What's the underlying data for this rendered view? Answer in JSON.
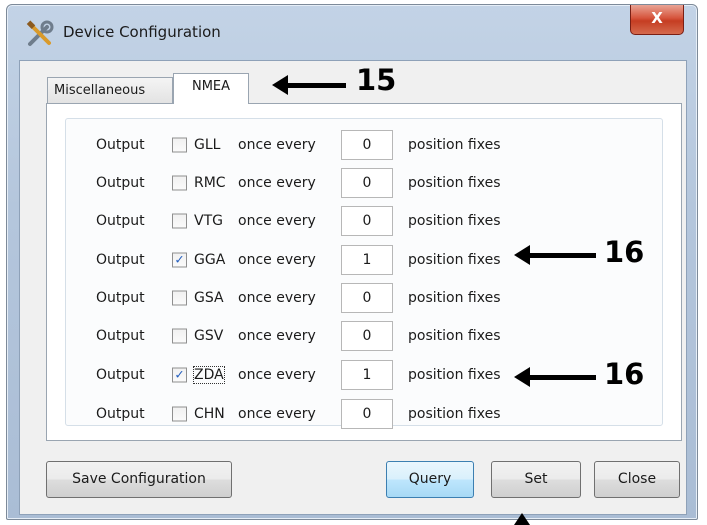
{
  "window": {
    "title": "Device Configuration",
    "close_glyph": "X"
  },
  "tabs": [
    {
      "label": "Miscellaneous",
      "selected": false
    },
    {
      "label": "NMEA",
      "selected": true
    }
  ],
  "nmea_rows": [
    {
      "prefix": "Output",
      "sentence": "GLL",
      "checked": false,
      "mid": "once every",
      "value": "0",
      "suffix": "position fixes"
    },
    {
      "prefix": "Output",
      "sentence": "RMC",
      "checked": false,
      "mid": "once every",
      "value": "0",
      "suffix": "position fixes"
    },
    {
      "prefix": "Output",
      "sentence": "VTG",
      "checked": false,
      "mid": "once every",
      "value": "0",
      "suffix": "position fixes"
    },
    {
      "prefix": "Output",
      "sentence": "GGA",
      "checked": true,
      "mid": "once every",
      "value": "1",
      "suffix": "position fixes"
    },
    {
      "prefix": "Output",
      "sentence": "GSA",
      "checked": false,
      "mid": "once every",
      "value": "0",
      "suffix": "position fixes"
    },
    {
      "prefix": "Output",
      "sentence": "GSV",
      "checked": false,
      "mid": "once every",
      "value": "0",
      "suffix": "position fixes"
    },
    {
      "prefix": "Output",
      "sentence": "ZDA",
      "checked": true,
      "focused": true,
      "mid": "once every",
      "value": "1",
      "suffix": "position fixes"
    },
    {
      "prefix": "Output",
      "sentence": "CHN",
      "checked": false,
      "mid": "once every",
      "value": "0",
      "suffix": "position fixes"
    }
  ],
  "buttons": {
    "save": "Save Configuration",
    "query": "Query",
    "set": "Set",
    "close": "Close"
  },
  "annotations": {
    "tab_callout": "15",
    "row_callout_1": "16",
    "row_callout_2": "16"
  },
  "icons": {
    "app": "tools-icon",
    "check_glyph": "✓"
  }
}
